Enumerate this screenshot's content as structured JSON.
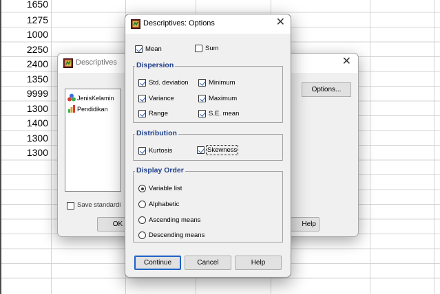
{
  "sheet": {
    "column_values": [
      "1650",
      "1275",
      "1000",
      "2250",
      "2400",
      "1350",
      "9999",
      "1300",
      "1400",
      "1300",
      "1300"
    ]
  },
  "descriptives_dialog": {
    "title": "Descriptives",
    "variables": [
      {
        "name": "JenisKelamin",
        "icon": "nominal-variable-icon"
      },
      {
        "name": "Pendidikan",
        "icon": "ordinal-variable-icon"
      }
    ],
    "save_label": "Save standardi",
    "options_button": "Options...",
    "ok_button": "OK",
    "help_button": "Help"
  },
  "options_dialog": {
    "title": "Descriptives: Options",
    "mean_label": "Mean",
    "mean_checked": true,
    "sum_label": "Sum",
    "sum_checked": false,
    "dispersion": {
      "title": "Dispersion",
      "items": [
        {
          "label": "Std. deviation",
          "checked": true
        },
        {
          "label": "Minimum",
          "checked": true
        },
        {
          "label": "Variance",
          "checked": true
        },
        {
          "label": "Maximum",
          "checked": true
        },
        {
          "label": "Range",
          "checked": true
        },
        {
          "label": "S.E. mean",
          "checked": true
        }
      ]
    },
    "distribution": {
      "title": "Distribution",
      "items": [
        {
          "label": "Kurtosis",
          "checked": true
        },
        {
          "label": "Skewness",
          "checked": true
        }
      ]
    },
    "display_order": {
      "title": "Display Order",
      "options": [
        "Variable list",
        "Alphabetic",
        "Ascending means",
        "Descending means"
      ],
      "selected": "Variable list"
    },
    "buttons": {
      "continue": "Continue",
      "cancel": "Cancel",
      "help": "Help"
    }
  },
  "colors": {
    "group_title": "#1e3f8a",
    "dialog_bg": "#f0f0f0",
    "check_mark": "#2a5fb0",
    "default_button_border": "#1e62c6"
  }
}
